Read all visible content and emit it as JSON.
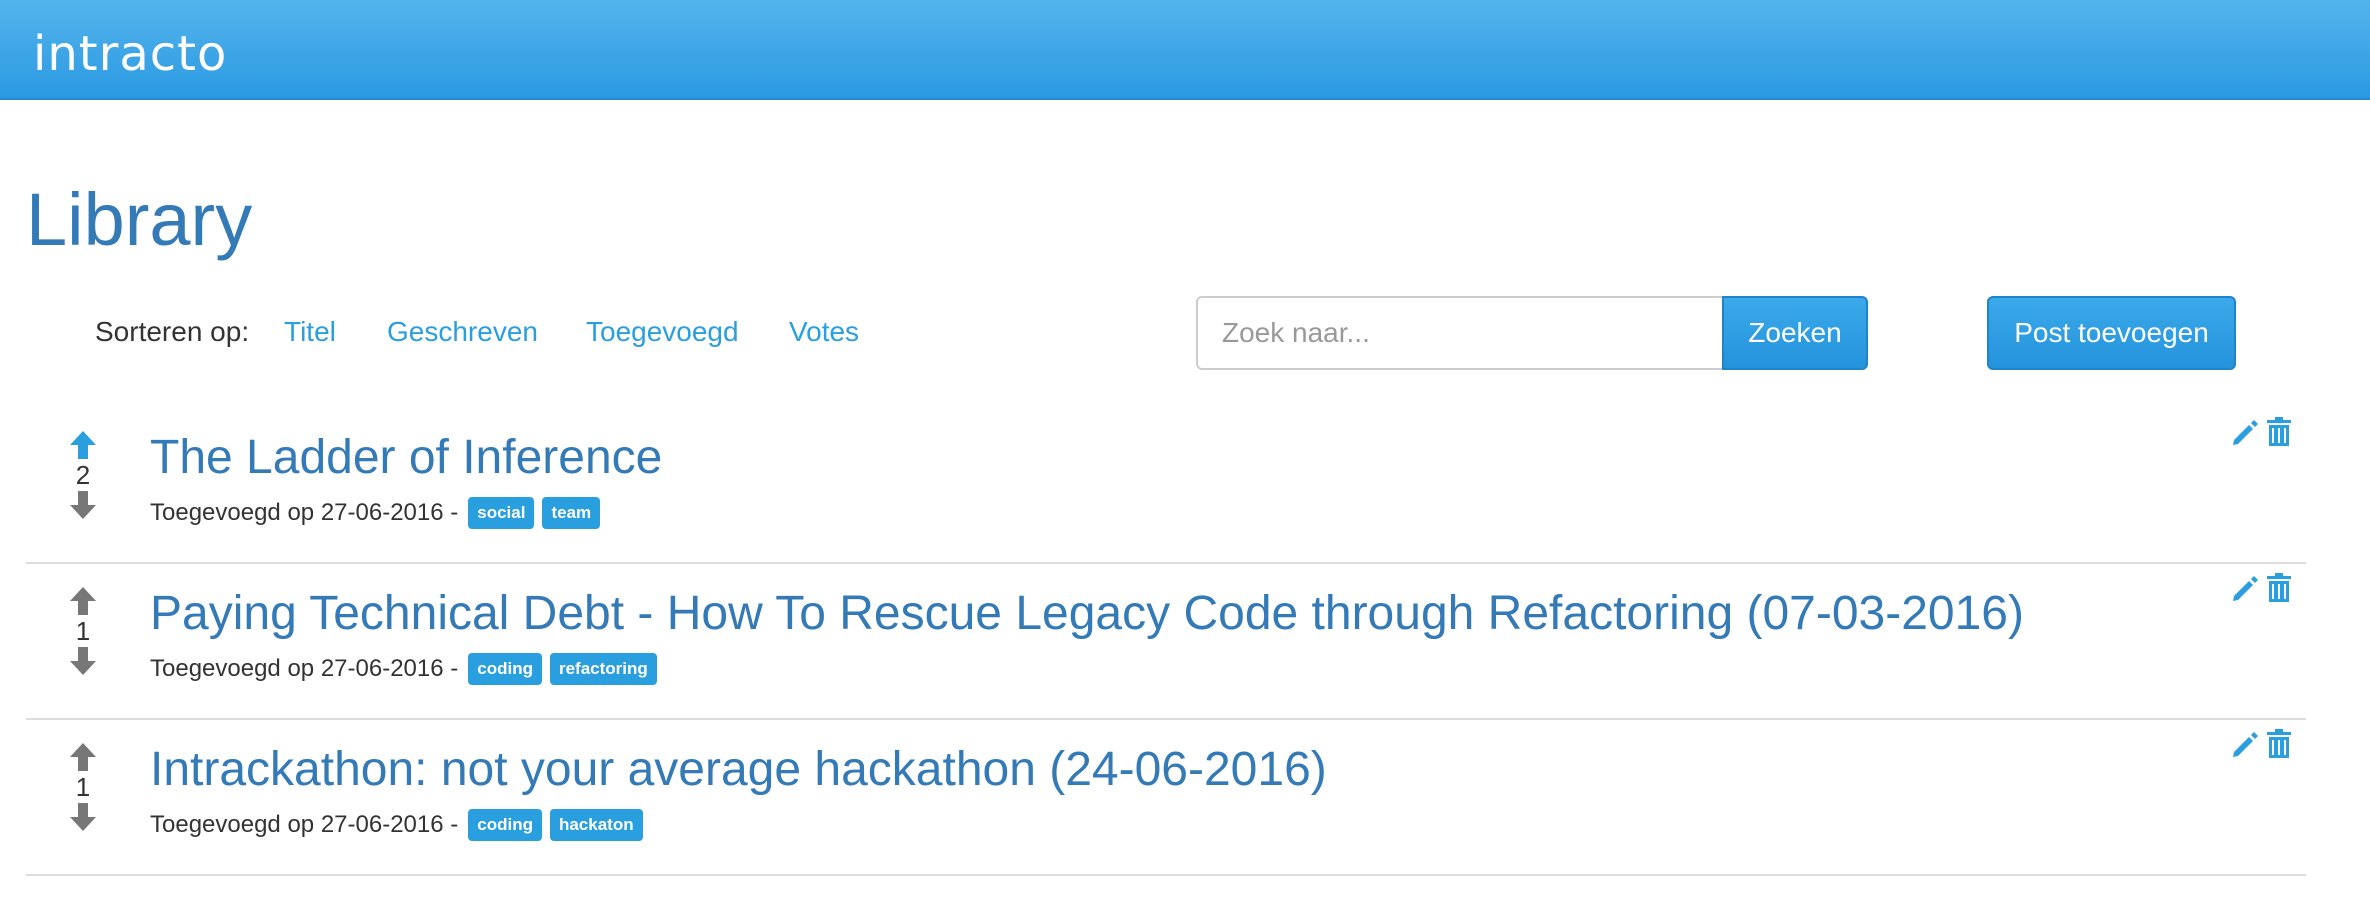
{
  "header": {
    "brand": "intracto"
  },
  "page": {
    "title": "Library"
  },
  "sort": {
    "label": "Sorteren op:",
    "options": [
      "Titel",
      "Geschreven",
      "Toegevoegd",
      "Votes"
    ]
  },
  "search": {
    "placeholder": "Zoek naar...",
    "value": "",
    "button_label": "Zoeken"
  },
  "actions": {
    "add_post_label": "Post toevoegen"
  },
  "colors": {
    "accent": "#2a9fe0",
    "title": "#337ab7",
    "vote_active": "#2a9fe0",
    "vote_inactive": "#777777"
  },
  "posts": [
    {
      "title": "The Ladder of Inference",
      "votes": "2",
      "meta": "Toegevoegd op 27-06-2016 -",
      "tags": [
        "social",
        "team"
      ],
      "upvoted": true
    },
    {
      "title": "Paying Technical Debt - How To Rescue Legacy Code through Refactoring (07-03-2016)",
      "votes": "1",
      "meta": "Toegevoegd op 27-06-2016 -",
      "tags": [
        "coding",
        "refactoring"
      ],
      "upvoted": false
    },
    {
      "title": "Intrackathon: not your average hackathon (24-06-2016)",
      "votes": "1",
      "meta": "Toegevoegd op 27-06-2016 -",
      "tags": [
        "coding",
        "hackaton"
      ],
      "upvoted": false
    }
  ]
}
